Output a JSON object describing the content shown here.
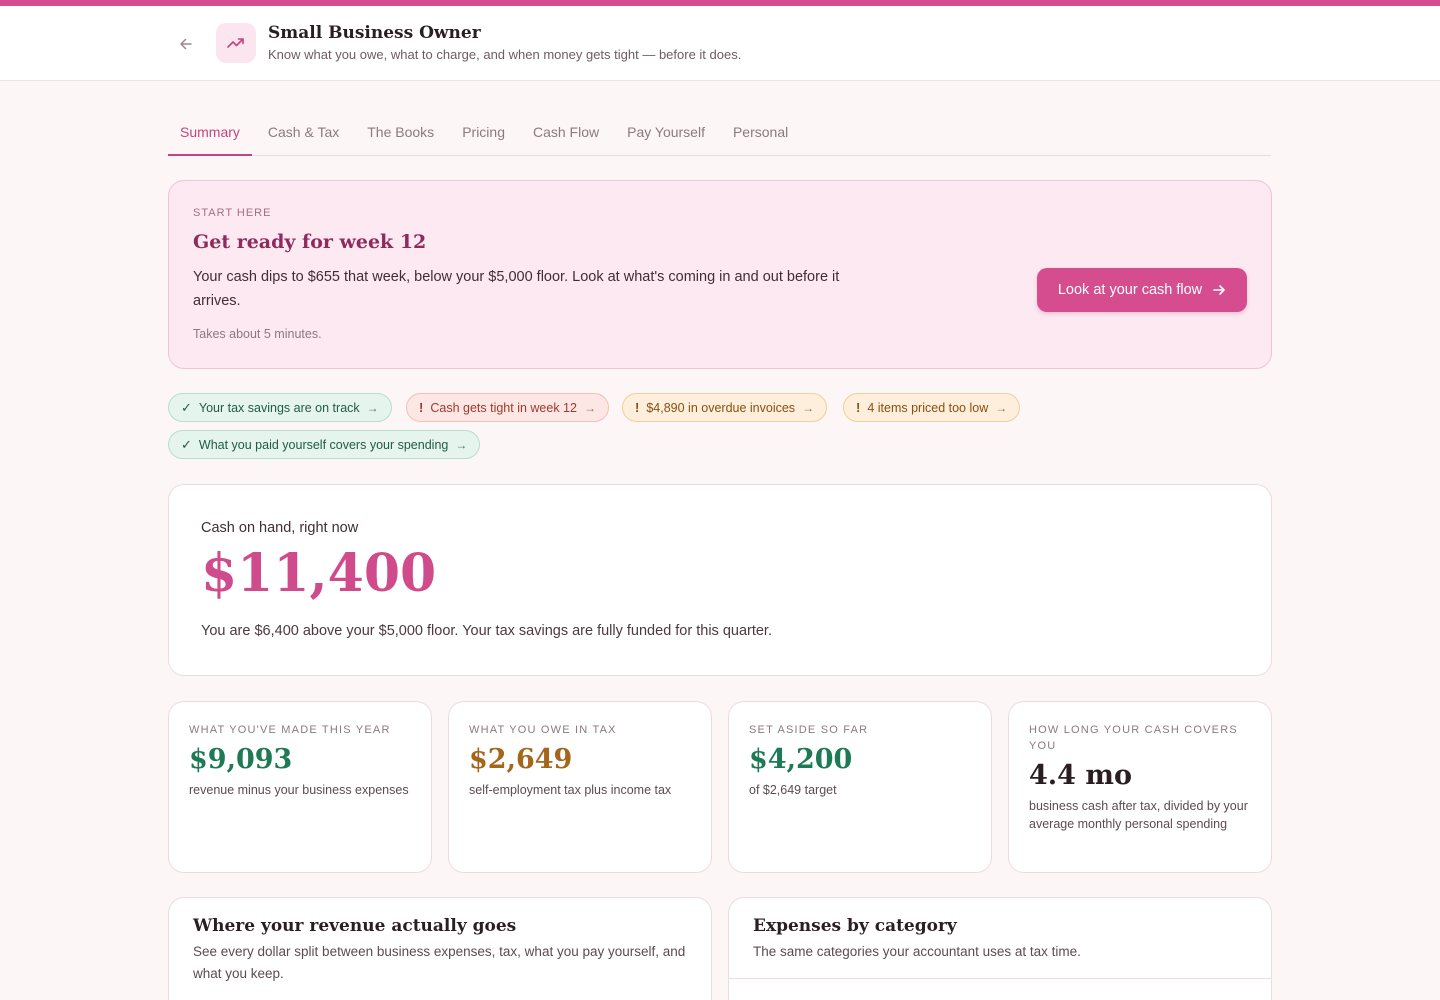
{
  "header": {
    "title": "Small Business Owner",
    "subtitle": "Know what you owe, what to charge, and when money gets tight — before it does.",
    "accent_color": "#d54d8f"
  },
  "tabs": [
    {
      "label": "Summary",
      "active": true
    },
    {
      "label": "Cash & Tax",
      "active": false
    },
    {
      "label": "The Books",
      "active": false
    },
    {
      "label": "Pricing",
      "active": false
    },
    {
      "label": "Cash Flow",
      "active": false
    },
    {
      "label": "Pay Yourself",
      "active": false
    },
    {
      "label": "Personal",
      "active": false
    }
  ],
  "start_card": {
    "eyebrow": "START HERE",
    "title": "Get ready for week 12",
    "body": "Your cash dips to $655 that week, below your $5,000 floor. Look at what's coming in and out before it arrives.",
    "note": "Takes about 5 minutes.",
    "cta_label": "Look at your cash flow"
  },
  "pills": [
    {
      "label": "Your tax savings are on track",
      "status": "ok",
      "mark": "✓"
    },
    {
      "label": "Cash gets tight in week 12",
      "status": "bad",
      "mark": "!"
    },
    {
      "label": "$4,890 in overdue invoices",
      "status": "warn",
      "mark": "!"
    },
    {
      "label": "4 items priced too low",
      "status": "warn",
      "mark": "!"
    },
    {
      "label": "What you paid yourself covers your spending",
      "status": "ok",
      "mark": "✓"
    }
  ],
  "cash_on_hand": {
    "label": "Cash on hand, right now",
    "amount": "$11,400",
    "note": "You are $6,400 above your $5,000 floor. Your tax savings are fully funded for this quarter."
  },
  "stats": [
    {
      "label": "WHAT YOU'VE MADE THIS YEAR",
      "value": "$9,093",
      "desc": "revenue minus your business expenses"
    },
    {
      "label": "WHAT YOU OWE IN TAX",
      "value": "$2,649",
      "desc": "self-employment tax plus income tax"
    },
    {
      "label": "SET ASIDE SO FAR",
      "value": "$4,200",
      "desc": "of $2,649 target"
    },
    {
      "label": "HOW LONG YOUR CASH COVERS YOU",
      "value": "4.4 mo",
      "desc": "business cash after tax, divided by your average monthly personal spending"
    }
  ],
  "panels": [
    {
      "title": "Where your revenue actually goes",
      "body": "See every dollar split between business expenses, tax, what you pay yourself, and what you keep."
    },
    {
      "title": "Expenses by category",
      "body": "The same categories your accountant uses at tax time."
    }
  ]
}
